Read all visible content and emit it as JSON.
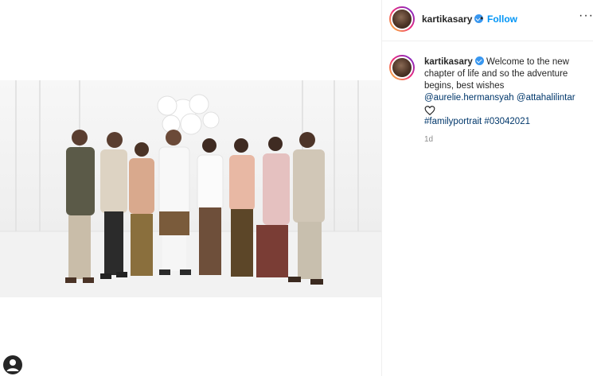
{
  "post": {
    "username": "kartikasary",
    "follow_label": "Follow",
    "separator": "•",
    "more_label": "···"
  },
  "caption": {
    "username": "kartikasary",
    "text": "Welcome to the new chapter of life and so the adventure begins, best wishes",
    "mention_1": "@aurelie.hermansyah",
    "mention_2": "@attahalilintar",
    "hashtag_1": "#familyportrait",
    "hashtag_2": "#03042021",
    "time": "1d"
  },
  "colors": {
    "follow": "#0095f6",
    "verified": "#3897f0",
    "link": "#00376b",
    "muted": "#8e8e8e"
  },
  "icons": [
    "verified-badge-icon",
    "heart-icon",
    "more-options-icon",
    "profile-icon"
  ]
}
